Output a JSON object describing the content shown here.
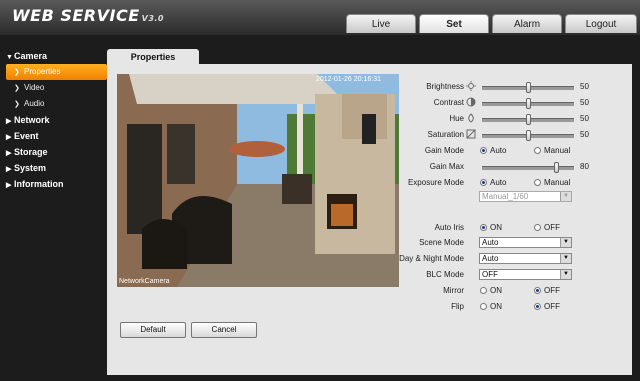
{
  "app": {
    "title": "WEB SERVICE",
    "version": "V3.0"
  },
  "tabs": [
    {
      "label": "Live"
    },
    {
      "label": "Set"
    },
    {
      "label": "Alarm"
    },
    {
      "label": "Logout"
    }
  ],
  "nav": {
    "camera": "Camera",
    "properties": "Properties",
    "video": "Video",
    "audio": "Audio",
    "network": "Network",
    "event": "Event",
    "storage": "Storage",
    "system": "System",
    "information": "Information"
  },
  "content_tab": "Properties",
  "preview": {
    "timestamp": "2012-01-26 20:16:31",
    "channel_name": "NetworkCamera"
  },
  "settings": {
    "brightness": {
      "label": "Brightness",
      "value": "50",
      "level": 0.5
    },
    "contrast": {
      "label": "Contrast",
      "value": "50",
      "level": 0.5
    },
    "hue": {
      "label": "Hue",
      "value": "50",
      "level": 0.5
    },
    "saturation": {
      "label": "Saturation",
      "value": "50",
      "level": 0.5
    },
    "gain_mode": {
      "label": "Gain Mode",
      "options": [
        "Auto",
        "Manual"
      ],
      "selected": "Auto"
    },
    "gain_max": {
      "label": "Gain Max",
      "value": "80",
      "level": 0.8
    },
    "exposure_mode": {
      "label": "Exposure Mode",
      "options": [
        "Auto",
        "Manual"
      ],
      "selected": "Auto"
    },
    "exposure_value": "Manual_1/60",
    "auto_iris": {
      "label": "Auto Iris",
      "options": [
        "ON",
        "OFF"
      ],
      "selected": "ON"
    },
    "scene_mode": {
      "label": "Scene Mode",
      "value": "Auto"
    },
    "day_night_mode": {
      "label": "Day & Night Mode",
      "value": "Auto"
    },
    "blc_mode": {
      "label": "BLC Mode",
      "value": "OFF"
    },
    "mirror": {
      "label": "Mirror",
      "options": [
        "ON",
        "OFF"
      ],
      "selected": "OFF"
    },
    "flip": {
      "label": "Flip",
      "options": [
        "ON",
        "OFF"
      ],
      "selected": "OFF"
    }
  },
  "buttons": {
    "default": "Default",
    "cancel": "Cancel"
  },
  "colors": {
    "accent": "#f08000",
    "header": "#3a3a3a",
    "panel": "#e6e6e6"
  }
}
